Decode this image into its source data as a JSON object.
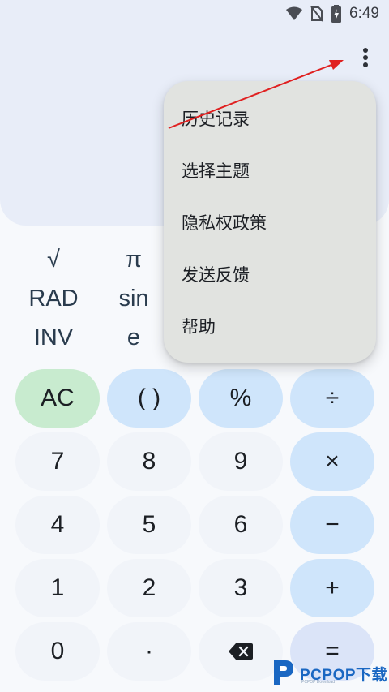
{
  "status_bar": {
    "time": "6:49",
    "icons": [
      "wifi-icon",
      "no-sim-icon",
      "battery-charging-icon"
    ]
  },
  "toolbar": {
    "overflow_icon": "more-vert-icon"
  },
  "scientific": {
    "col1": [
      "√",
      "RAD",
      "INV"
    ],
    "col2": [
      "π",
      "sin",
      "e"
    ]
  },
  "keypad": {
    "row1": [
      "AC",
      "( )",
      "%",
      "÷"
    ],
    "row2": [
      "7",
      "8",
      "9",
      "×"
    ],
    "row3": [
      "4",
      "5",
      "6",
      "−"
    ],
    "row4": [
      "1",
      "2",
      "3",
      "+"
    ],
    "row5": [
      "0",
      "·",
      "backspace-icon",
      "="
    ]
  },
  "menu": {
    "items": [
      "历史记录",
      "选择主题",
      "隐私权政策",
      "发送反馈",
      "帮助"
    ]
  },
  "annotation": {
    "arrow_color": "#e02020"
  },
  "watermark": {
    "text": "PCPOP下载",
    "sub": "PCPOP Download"
  },
  "colors": {
    "display_bg": "#e8edf8",
    "op_key": "#cfe5fb",
    "ac_key": "#c8ebcf",
    "num_key": "#f1f4f9",
    "menu_bg": "#e1e3e0"
  }
}
